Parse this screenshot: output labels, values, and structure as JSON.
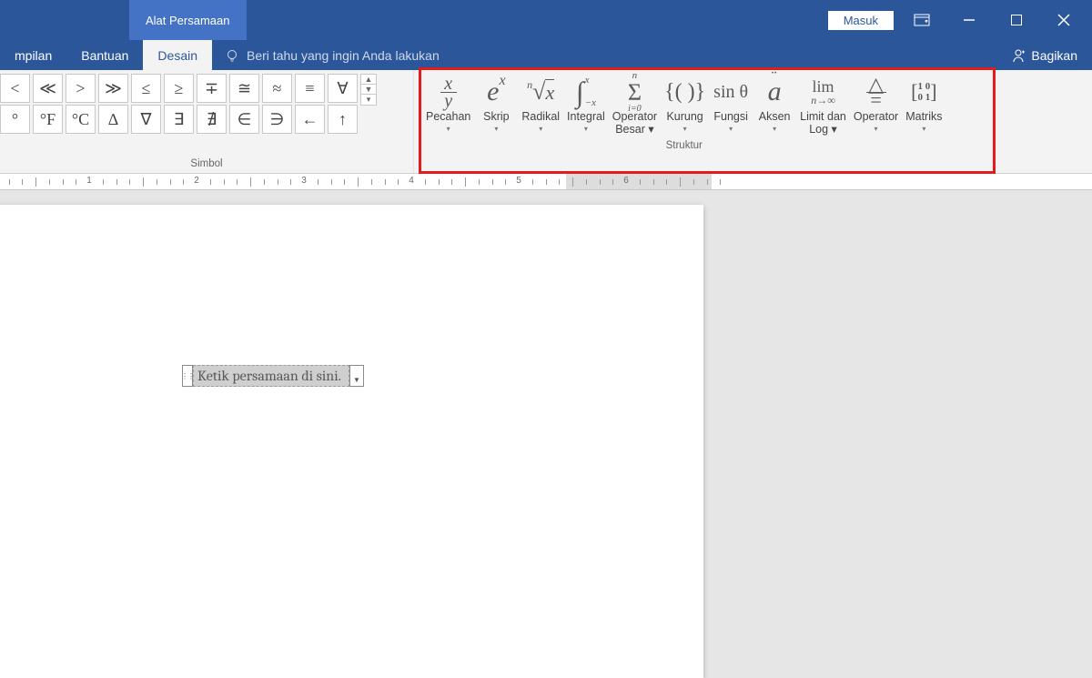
{
  "titlebar": {
    "context_tab": "Alat Persamaan",
    "signin": "Masuk"
  },
  "tabs": {
    "tampilan": "mpilan",
    "bantuan": "Bantuan",
    "desain": "Desain",
    "tellme": "Beri tahu yang ingin Anda lakukan",
    "share": "Bagikan"
  },
  "symbols": {
    "group_label": "Simbol",
    "row1": [
      "<",
      "≪",
      ">",
      "≫",
      "≤",
      "≥",
      "∓",
      "≅",
      "≈",
      "≡",
      "∀"
    ],
    "row2": [
      "°",
      "°F",
      "°C",
      "∆",
      "∇",
      "∃",
      "∄",
      "∈",
      "∋",
      "←",
      "↑"
    ]
  },
  "structures": {
    "group_label": "Struktur",
    "items": [
      {
        "name": "pecahan",
        "label": "Pecahan",
        "split": false
      },
      {
        "name": "skrip",
        "label": "Skrip",
        "split": false
      },
      {
        "name": "radikal",
        "label": "Radikal",
        "split": false
      },
      {
        "name": "integral",
        "label": "Integral",
        "split": false
      },
      {
        "name": "operator",
        "label": "Operator\nBesar",
        "split": true
      },
      {
        "name": "kurung",
        "label": "Kurung",
        "split": false
      },
      {
        "name": "fungsi",
        "label": "Fungsi",
        "split": false
      },
      {
        "name": "aksen",
        "label": "Aksen",
        "split": false
      },
      {
        "name": "limit",
        "label": "Limit dan\nLog",
        "split": true
      },
      {
        "name": "operator2",
        "label": "Operator",
        "split": false
      },
      {
        "name": "matriks",
        "label": "Matriks",
        "split": false
      }
    ]
  },
  "ruler": {
    "numbers": [
      1,
      2,
      3,
      4,
      5,
      6
    ]
  },
  "equation": {
    "placeholder": "Ketik persamaan di sini."
  }
}
